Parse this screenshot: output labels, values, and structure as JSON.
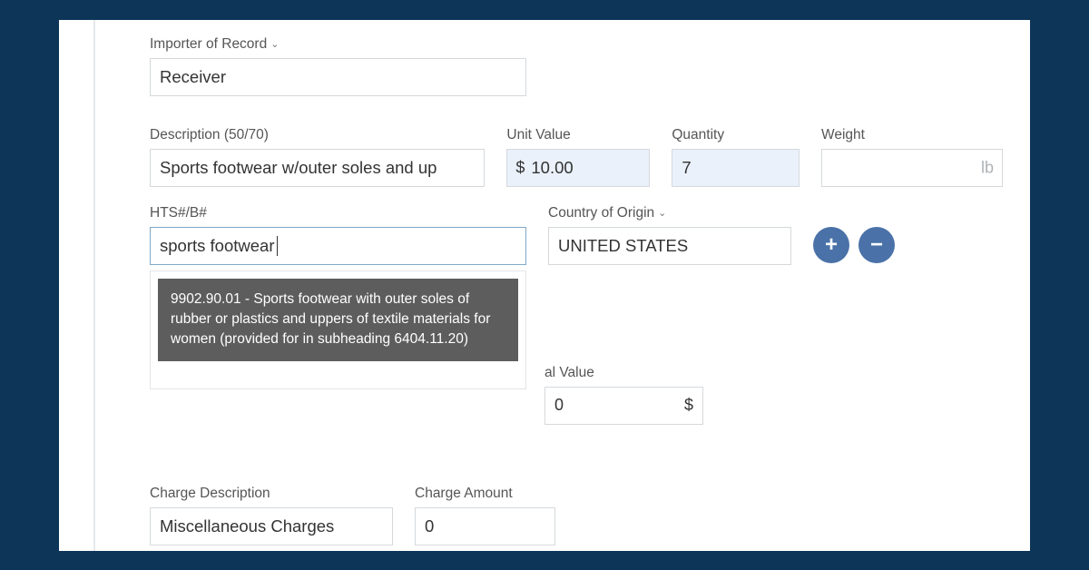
{
  "importer": {
    "label": "Importer of Record",
    "value": "Receiver"
  },
  "description": {
    "label": "Description (50/70)",
    "value": "Sports footwear w/outer soles and up"
  },
  "unit_value": {
    "label": "Unit Value",
    "prefix": "$",
    "value": "10.00"
  },
  "quantity": {
    "label": "Quantity",
    "value": "7"
  },
  "weight": {
    "label": "Weight",
    "value": "",
    "suffix": "lb"
  },
  "hts": {
    "label": "HTS#/B#",
    "value": "sports footwear",
    "suggestion": "9902.90.01 - Sports footwear with outer soles of rubber or plastics and uppers of textile materials for women (provided for in subheading 6404.11.20)"
  },
  "country": {
    "label": "Country of Origin",
    "value": "UNITED STATES"
  },
  "total_value": {
    "label_partial": "al Value",
    "value_partial": "0",
    "suffix": "$"
  },
  "charge": {
    "desc_label": "Charge Description",
    "desc_value": "Miscellaneous Charges",
    "amount_label": "Charge Amount",
    "amount_value": "0"
  }
}
